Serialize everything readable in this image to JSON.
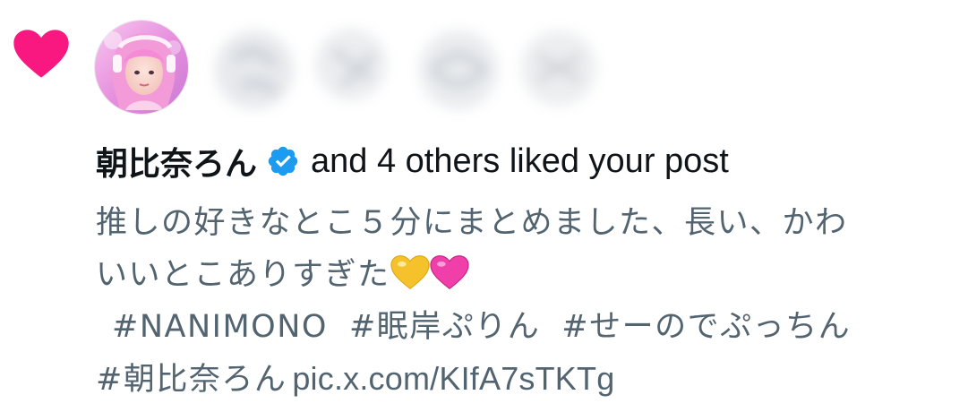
{
  "notification": {
    "type": "like",
    "icon": "heart-icon",
    "user_name": "朝比奈ろん",
    "verified": true,
    "action_text": "and 4 others liked your post",
    "post": {
      "line1": "推しの好きなとこ５分にまとめました、長い、かわ",
      "line2": "いいとこありすぎた",
      "emojis": [
        "yellow-heart-emoji",
        "pink-heart-emoji"
      ],
      "hashtags": [
        "#NANIMONO",
        "#眠岸ぷりん",
        "#せーのでぷっちん"
      ],
      "last_hashtag": "#朝比奈ろん",
      "link": "pic.x.com/KIfA7sTKTg"
    }
  },
  "colors": {
    "like_pink": "#f91880",
    "verified_blue": "#1d9bf0",
    "text_primary": "#0f1419",
    "text_secondary": "#536471"
  }
}
